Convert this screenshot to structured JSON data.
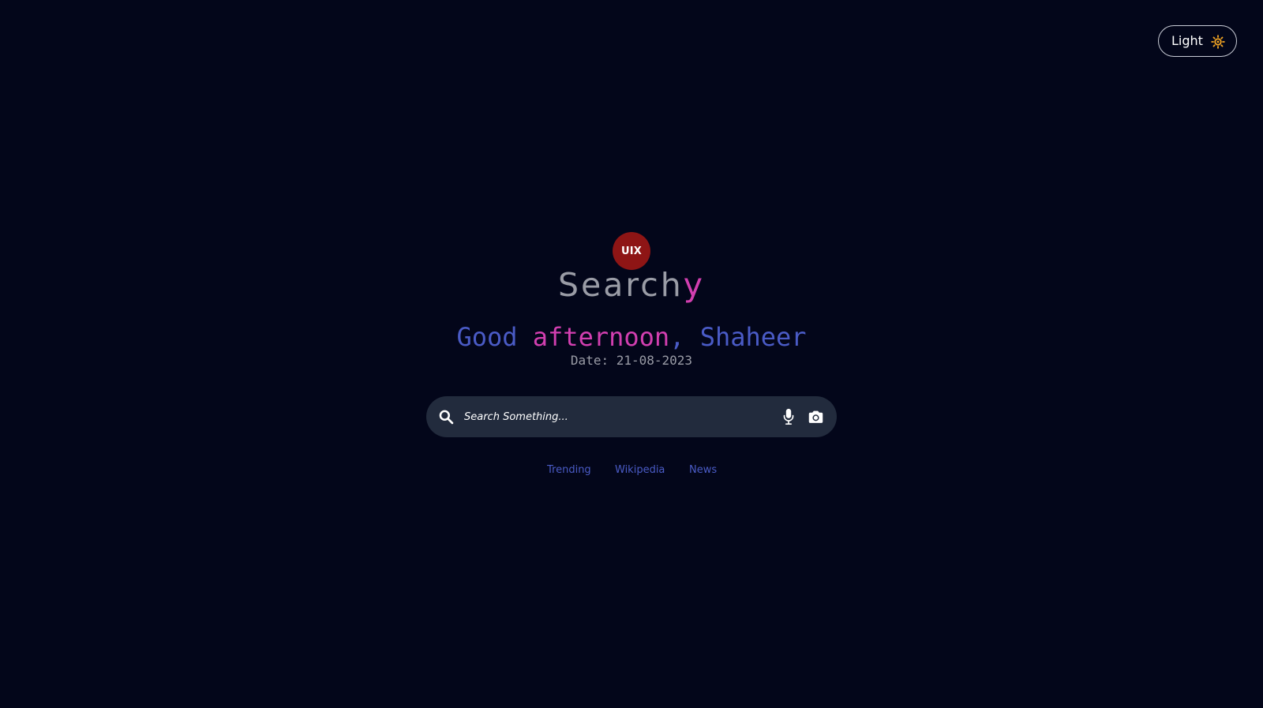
{
  "theme_toggle": {
    "label": "Light",
    "icon": "sun-icon",
    "icon_color": "#f5a623"
  },
  "logo": {
    "badge_text": "UIX",
    "badge_color": "#8e1515",
    "brand_main": "Search",
    "brand_accent": "y"
  },
  "greeting": {
    "salutation": "Good",
    "time_of_day": "afternoon",
    "separator": ",",
    "name": "Shaheer",
    "date_label": "Date:",
    "date_value": "21-08-2023"
  },
  "search": {
    "placeholder": "Search Something...",
    "icons": [
      "search-icon",
      "microphone-icon",
      "camera-icon"
    ]
  },
  "quick_links": [
    {
      "label": "Trending"
    },
    {
      "label": "Wikipedia"
    },
    {
      "label": "News"
    }
  ],
  "colors": {
    "background": "#03061a",
    "accent_blue": "#4a5bc6",
    "accent_pink": "#d23fb0",
    "search_bg": "#222b3d"
  }
}
